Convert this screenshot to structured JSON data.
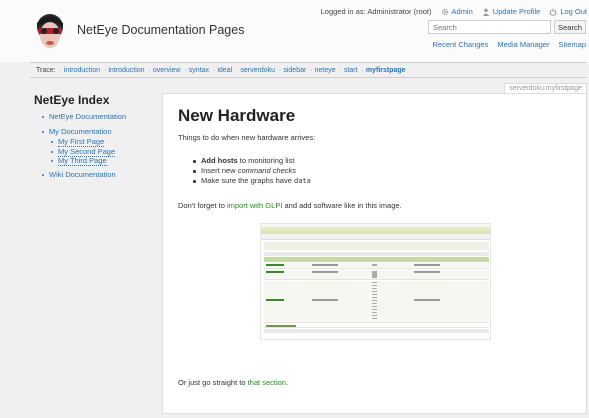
{
  "header": {
    "site_title": "NetEye Documentation Pages",
    "logged_in_as": "Logged in as: Administrator (root)",
    "user_links": [
      {
        "label": "Admin",
        "icon": "gear-icon"
      },
      {
        "label": "Update Profile",
        "icon": "user-icon"
      },
      {
        "label": "Log Out",
        "icon": "power-icon"
      }
    ],
    "search": {
      "placeholder": "Search",
      "button_label": "Search"
    },
    "tools": [
      "Recent Changes",
      "Media Manager",
      "Sitemap"
    ]
  },
  "breadcrumb": {
    "label": "Trace:",
    "items": [
      "introduction",
      "introduction",
      "overview",
      "syntax",
      "ideal",
      "serverdoku",
      "sidebar",
      "neteye",
      "start"
    ],
    "current": "myfirstpage"
  },
  "sidebar": {
    "title": "NetEye Index",
    "item1": "NetEye Documentation",
    "item2": "My Documentation",
    "sub1": "My First Page",
    "sub2": "My Second Page",
    "sub3": "My Third Page",
    "item3": "Wiki Documentation"
  },
  "page": {
    "id_tag": "serverdoku:myfirstpage",
    "heading": "New Hardware",
    "intro": "Things to do when new hardware arrives:",
    "bullet1_strong": "Add hosts",
    "bullet1_rest": " to monitoring list",
    "bullet2_pre": "Insert new ",
    "bullet2_em": "command checks",
    "bullet3_pre": "Make sure the graphs have ",
    "bullet3_code": "data",
    "p2_pre": "Don't forget to ",
    "p2_link": "import with GLPI",
    "p2_post": " and add software like in this image.",
    "p3_pre": "Or just go straight to ",
    "p3_link": "that section",
    "p3_post": "."
  },
  "colors": {
    "link": "#2b73b7",
    "external_link": "#2a8a2a",
    "page_bg": "#f0f0f0"
  }
}
